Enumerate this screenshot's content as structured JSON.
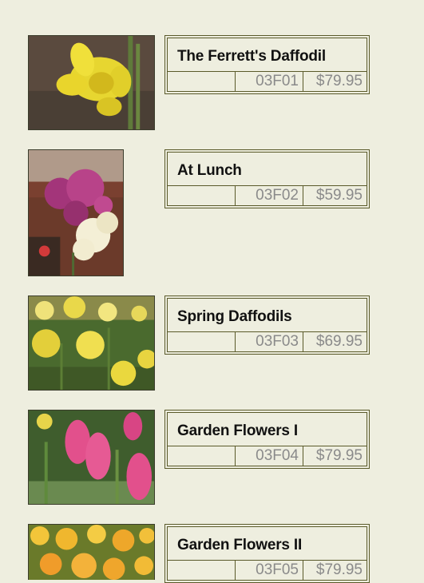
{
  "products": [
    {
      "name": "The Ferrett's Daffodil",
      "code": "03F01",
      "price": "$79.95",
      "image": "yellow-daffodil-photo"
    },
    {
      "name": "At Lunch",
      "code": "03F02",
      "price": "$59.95",
      "image": "pink-white-carnations-photo"
    },
    {
      "name": "Spring Daffodils",
      "code": "03F03",
      "price": "$69.95",
      "image": "daffodil-garden-photo"
    },
    {
      "name": "Garden Flowers I",
      "code": "03F04",
      "price": "$79.95",
      "image": "pink-hyacinths-photo"
    },
    {
      "name": "Garden Flowers II",
      "code": "03F05",
      "price": "$79.95",
      "image": "orange-yellow-flowers-photo"
    }
  ],
  "colors": {
    "background": "#eeeedf",
    "border": "#5a5a2a",
    "title_text": "#111111",
    "muted_text": "#8a8a8a"
  }
}
